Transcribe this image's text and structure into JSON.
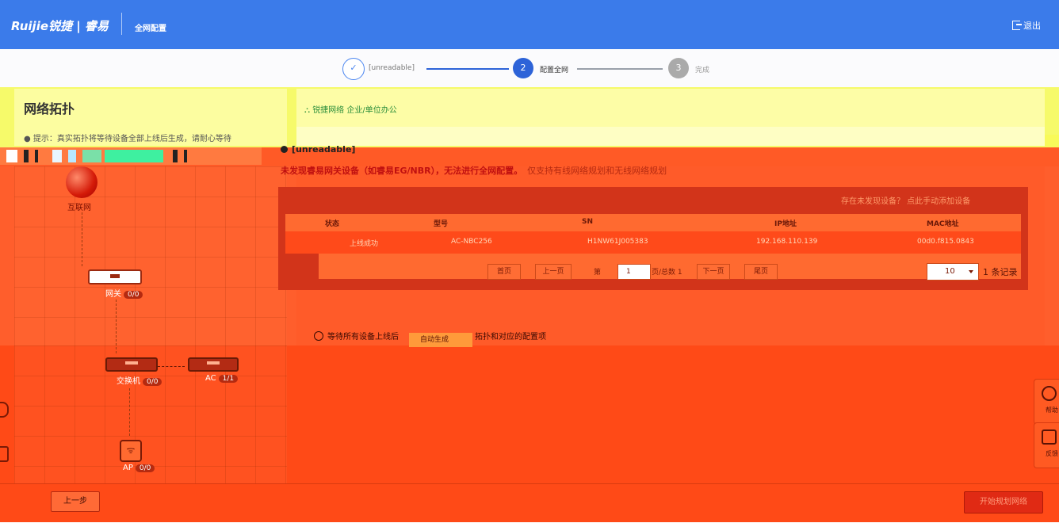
{
  "header": {
    "logo": "Ruijie锐捷 | 睿易",
    "nav_title": "全网配置",
    "logout_label": "退出"
  },
  "stepper": {
    "steps": [
      {
        "number": "✓",
        "label": "[unreadable]"
      },
      {
        "number": "2",
        "label": "配置全网"
      },
      {
        "number": "3",
        "label": "完成"
      }
    ]
  },
  "left_panel": {
    "title": "网络拓扑",
    "tip": "● 提示：真实拓扑将等待设备全部上线后生成，请耐心等待"
  },
  "right_panel": {
    "breadcrumb": "锐捷网络  企业/单位办公",
    "progress_label": "[unreadable]",
    "warning_main": "未发现睿易网关设备（如睿易EG/NBR），无法进行全网配置。",
    "warning_sub": "仅支持有线网络规划和无线网络规划",
    "add_device_link": "存在未发现设备？ 点此手动添加设备",
    "wait_text": "等待所有设备上线后",
    "wait_auto": "自动生成",
    "wait_tail": "拓扑和对应的配置项"
  },
  "device_table": {
    "columns": [
      "状态",
      "型号",
      "SN",
      "IP地址",
      "MAC地址"
    ],
    "rows": [
      {
        "status": "上线成功",
        "model": "AC-NBC256",
        "sn": "H1NW61J005383",
        "ip": "192.168.110.139",
        "mac": "00d0.f815.0843"
      }
    ],
    "pagination": {
      "first": "首页",
      "prev": "上一页",
      "page_prefix": "第",
      "page_value": "1",
      "page_suffix": "页/总数 1",
      "next": "下一页",
      "last": "尾页",
      "page_size": "10",
      "total": "1 条记录"
    }
  },
  "topology": {
    "internet_label": "互联网",
    "gateway": {
      "label": "网关",
      "count": "0/0"
    },
    "switch": {
      "label": "交换机",
      "count": "0/0"
    },
    "ac": {
      "label": "AC",
      "count": "1/1"
    },
    "ap": {
      "label": "AP",
      "count": "0/0"
    }
  },
  "footer": {
    "prev_label": "上一步",
    "start_label": "开始规划网络"
  },
  "floating": {
    "help_label": "帮助",
    "feedback_label": "反馈"
  },
  "colors": {
    "header_blue": "#3b7bea",
    "step_active": "#2d63d8",
    "overlay_orange": "#ff5e2c",
    "overlay_yellow": "#f6fa6a",
    "warning_red": "#c01010"
  }
}
